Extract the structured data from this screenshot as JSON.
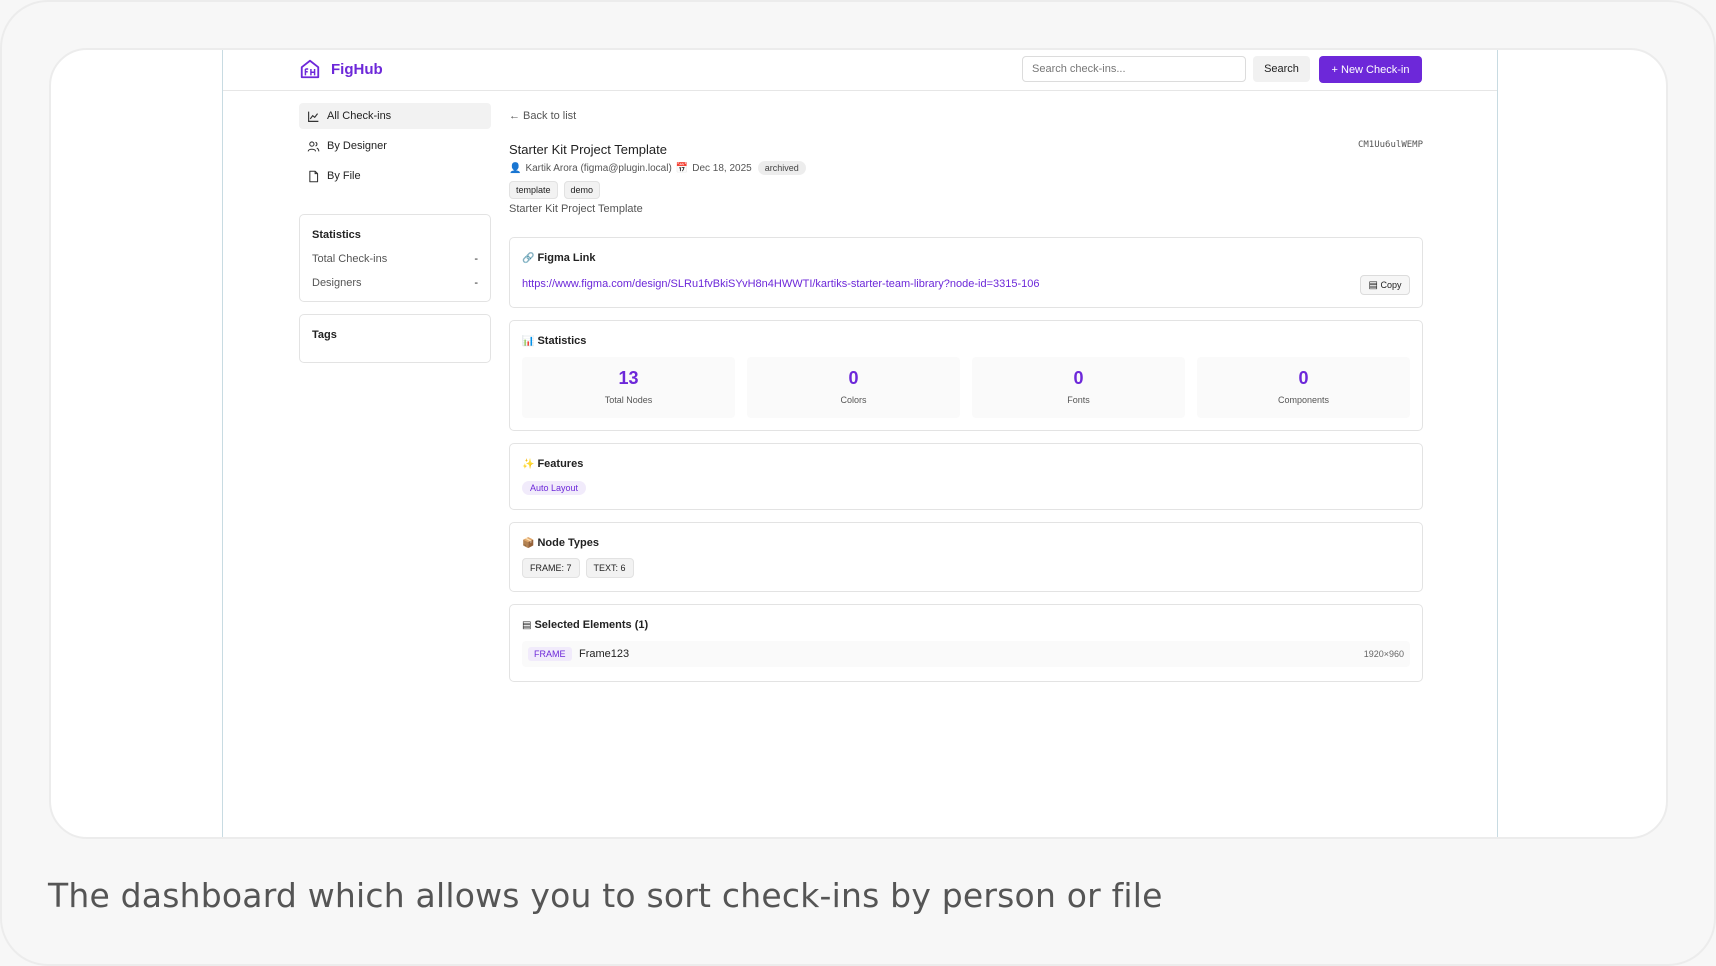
{
  "caption": "The dashboard which allows you to sort check-ins by person or file",
  "header": {
    "logo_text": "FigHub",
    "search_placeholder": "Search check-ins...",
    "search_label": "Search",
    "new_label": "+ New Check-in"
  },
  "sidebar": {
    "nav": [
      {
        "label": "All Check-ins",
        "icon": "chart-icon"
      },
      {
        "label": "By Designer",
        "icon": "users-icon"
      },
      {
        "label": "By File",
        "icon": "file-icon"
      }
    ],
    "stats_title": "Statistics",
    "stats": [
      {
        "label": "Total Check-ins",
        "value": "-"
      },
      {
        "label": "Designers",
        "value": "-"
      }
    ],
    "tags_title": "Tags"
  },
  "detail": {
    "back_label": "← Back to list",
    "title": "Starter Kit Project Template",
    "id": "CM1Uu6ulWEMP",
    "author": "Kartik Arora (figma@plugin.local)",
    "date": "Dec 18, 2025",
    "status": "archived",
    "tags": [
      "template",
      "demo"
    ],
    "description": "Starter Kit Project Template"
  },
  "figma_link": {
    "title": "Figma Link",
    "url": "https://www.figma.com/design/SLRu1fvBkiSYvH8n4HWWTI/kartiks-starter-team-library?node-id=3315-106",
    "copy_label": "Copy"
  },
  "statistics": {
    "title": "Statistics",
    "items": [
      {
        "value": "13",
        "label": "Total Nodes"
      },
      {
        "value": "0",
        "label": "Colors"
      },
      {
        "value": "0",
        "label": "Fonts"
      },
      {
        "value": "0",
        "label": "Components"
      }
    ]
  },
  "features": {
    "title": "Features",
    "items": [
      "Auto Layout"
    ]
  },
  "node_types": {
    "title": "Node Types",
    "items": [
      "FRAME: 7",
      "TEXT: 6"
    ]
  },
  "selected": {
    "title": "Selected Elements (1)",
    "items": [
      {
        "type": "FRAME",
        "name": "Frame123",
        "size": "1920×960"
      }
    ]
  },
  "colors": {
    "accent": "#6d28d9"
  }
}
